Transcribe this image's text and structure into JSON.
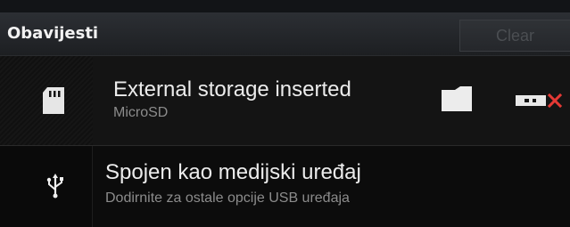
{
  "header": {
    "title": "Obavijesti",
    "clear_label": "Clear"
  },
  "notifications": [
    {
      "title": "External storage inserted",
      "subtitle": "MicroSD",
      "icon": "sd-card-icon",
      "actions": [
        "folder-icon",
        "unmount-icon"
      ]
    },
    {
      "title": "Spojen kao medijski uređaj",
      "subtitle": "Dodirnite za ostale opcije USB uređaja",
      "icon": "usb-icon"
    }
  ],
  "colors": {
    "unmount_x": "#e53935",
    "text_primary": "#ececec",
    "text_secondary": "#8c8c8c"
  }
}
